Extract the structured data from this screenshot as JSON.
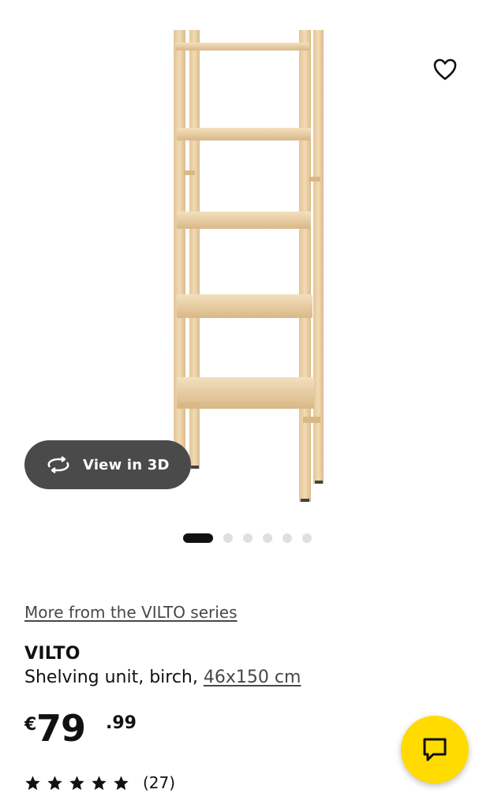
{
  "gallery": {
    "image_alt": "VILTO shelving unit, birch",
    "favourite_icon": "heart-outline-icon",
    "view3d": {
      "label": "View in 3D",
      "icon": "rotate-3d-icon"
    },
    "slides": {
      "total": 6,
      "active_index": 0
    }
  },
  "product": {
    "series_link": "More from the VILTO series",
    "name": "VILTO",
    "description": "Shelving unit, birch, ",
    "dimensions_link": "46x150 cm",
    "price": {
      "currency": "€",
      "integer": "79",
      "decimal": ".99"
    },
    "rating": {
      "stars": 5,
      "review_count": "(27)"
    }
  },
  "chat": {
    "icon": "chat-bubble-icon"
  },
  "colors": {
    "accent_yellow": "#ffdb00",
    "view3d_bg": "#4a4a4a",
    "dot_active": "#111111",
    "dot_inactive": "#dfdfdf",
    "wood": "#e9cfa4"
  }
}
